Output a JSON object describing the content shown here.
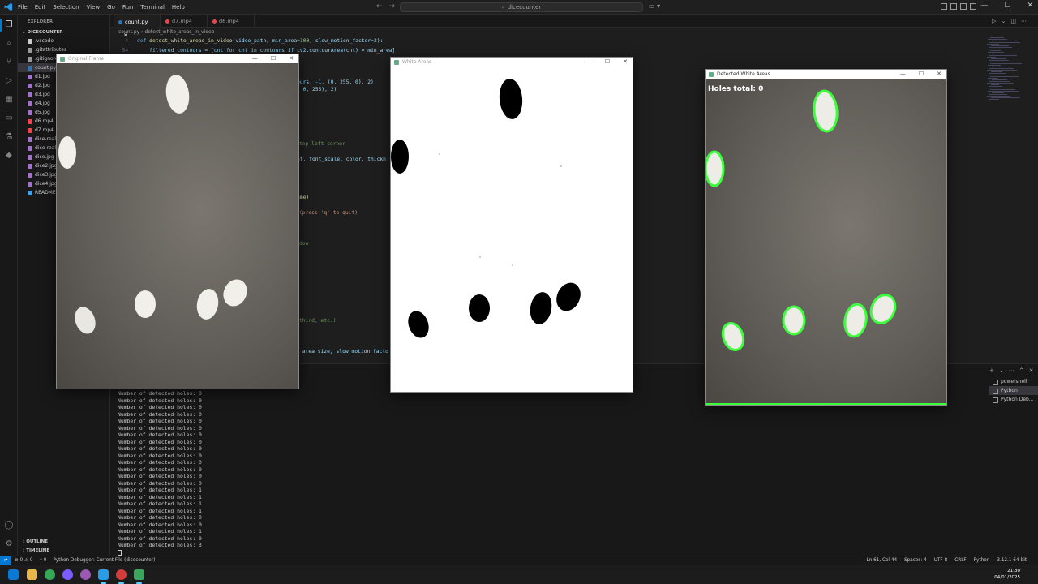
{
  "menu": [
    "File",
    "Edit",
    "Selection",
    "View",
    "Go",
    "Run",
    "Terminal",
    "Help"
  ],
  "search_text": "dicecounter",
  "sidebar": {
    "header": "EXPLORER",
    "project": "DICECOUNTER",
    "files": [
      {
        "name": ".vscode",
        "color": "#cccccc"
      },
      {
        "name": ".gitattributes",
        "color": "#999999"
      },
      {
        "name": ".gitignore",
        "color": "#999999"
      },
      {
        "name": "count.py",
        "color": "#3572a5",
        "selected": true
      },
      {
        "name": "d1.jpg",
        "color": "#a074c4"
      },
      {
        "name": "d2.jpg",
        "color": "#a074c4"
      },
      {
        "name": "d3.jpg",
        "color": "#a074c4"
      },
      {
        "name": "d4.jpg",
        "color": "#a074c4"
      },
      {
        "name": "d5.jpg",
        "color": "#a074c4"
      },
      {
        "name": "d6.mp4",
        "color": "#e5484d"
      },
      {
        "name": "d7.mp4",
        "color": "#e5484d"
      },
      {
        "name": "dice-real-",
        "color": "#a074c4"
      },
      {
        "name": "dice-real.",
        "color": "#a074c4"
      },
      {
        "name": "dice.jpg",
        "color": "#a074c4"
      },
      {
        "name": "dice2.jpg",
        "color": "#a074c4"
      },
      {
        "name": "dice3.jpg",
        "color": "#a074c4"
      },
      {
        "name": "dice4.jpg",
        "color": "#a074c4"
      },
      {
        "name": "README.m",
        "color": "#4a9fe0"
      }
    ],
    "outline": "OUTLINE",
    "timeline": "TIMELINE"
  },
  "tabs": [
    {
      "label": "count.py",
      "color": "#3572a5",
      "active": true,
      "close": "×"
    },
    {
      "label": "d7.mp4",
      "color": "#e5484d"
    },
    {
      "label": "d6.mp4",
      "color": "#e5484d"
    }
  ],
  "breadcrumbs": [
    "count.py",
    "detect_white_areas_in_video"
  ],
  "code": {
    "line_numbers": [
      "4",
      "54"
    ],
    "def_line": {
      "kw": "def ",
      "fn": "detect_white_areas_in_video",
      "args": "(video_path, min_area=",
      "n1": "100",
      ", slow_motion_factor=": "",
      "rest": ", slow_motion_factor=",
      "n2": "2",
      "end": "):"
    },
    "line54": "    filtered_contours = [cnt for cnt in contours if cv2.contourArea(cnt) > min_area]",
    "fragments": [
      "ours, -1, (0, 255, 0), 2)",
      ", 0, 255), 2)",
      "top-left corner",
      "nt, font_scale, color, thickn",
      "ame)",
      "(press 'q' to quit)",
      "dow",
      "third, etc.)",
      "_area_size, slow_motion_facto"
    ]
  },
  "terminal": {
    "lines": [
      "Number of detected holes: 0",
      "Number of detected holes: 0",
      "Number of detected holes: 0",
      "Number of detected holes: 0",
      "Number of detected holes: 0",
      "Number of detected holes: 0",
      "Number of detected holes: 0",
      "Number of detected holes: 0",
      "Number of detected holes: 0",
      "Number of detected holes: 0",
      "Number of detected holes: 0",
      "Number of detected holes: 0",
      "Number of detected holes: 0",
      "Number of detected holes: 0",
      "Number of detected holes: 1",
      "Number of detected holes: 1",
      "Number of detected holes: 1",
      "Number of detected holes: 1",
      "Number of detected holes: 0",
      "Number of detected holes: 0",
      "Number of detected holes: 1",
      "Number of detected holes: 0",
      "Number of detected holes: 3"
    ],
    "shells": [
      {
        "label": "powershell"
      },
      {
        "label": "Python",
        "selected": true
      },
      {
        "label": "Python Deb..."
      }
    ]
  },
  "statusbar": {
    "errors": "⊗ 0 ⚠ 0",
    "ports": "⑂ 0",
    "debug": "Python Debugger: Current File (dicecounter)",
    "position": "Ln 61, Col 44",
    "spaces": "Spaces: 4",
    "encoding": "UTF-8",
    "eol": "CRLF",
    "language": "Python",
    "interpreter": "3.12.1 64-bit"
  },
  "windows": {
    "original": {
      "title": "Original Frame"
    },
    "white": {
      "title": "White Areas"
    },
    "detected": {
      "title": "Detected White Areas",
      "overlay": "Holes total: 0"
    }
  },
  "clock": {
    "time": "21:30",
    "date": "04/01/2025"
  }
}
